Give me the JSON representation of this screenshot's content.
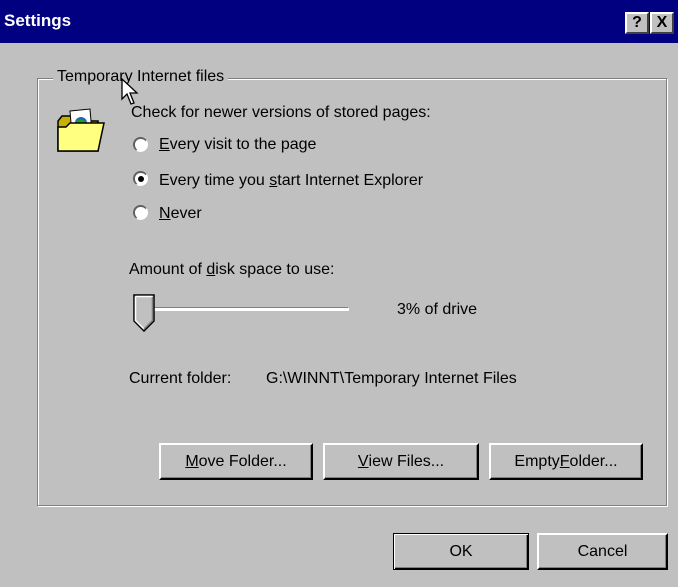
{
  "window": {
    "title": "Settings",
    "help_button": "?",
    "close_button": "X"
  },
  "group": {
    "legend": "Temporary Internet files"
  },
  "check_section": {
    "prompt": "Check for newer versions of stored pages:",
    "options": [
      {
        "label": "Every visit to the page",
        "checked": false
      },
      {
        "label": "Every time you start Internet Explorer",
        "checked": true
      },
      {
        "label": "Never",
        "checked": false
      }
    ]
  },
  "disk": {
    "label": "Amount of disk space to use:",
    "value_text": "3% of drive",
    "slider_value": 0.03
  },
  "folder": {
    "label": "Current folder:",
    "path": "G:\\WINNT\\Temporary Internet Files"
  },
  "buttons": {
    "move_folder": "Move Folder...",
    "view_files": "View Files...",
    "empty_folder": "Empty Folder...",
    "ok": "OK",
    "cancel": "Cancel"
  },
  "icons": {
    "folder": "open-folder-with-globe-icon",
    "cursor": "mouse-pointer-icon"
  },
  "colors": {
    "titlebar": "#000080",
    "face": "#c0c0c0"
  }
}
